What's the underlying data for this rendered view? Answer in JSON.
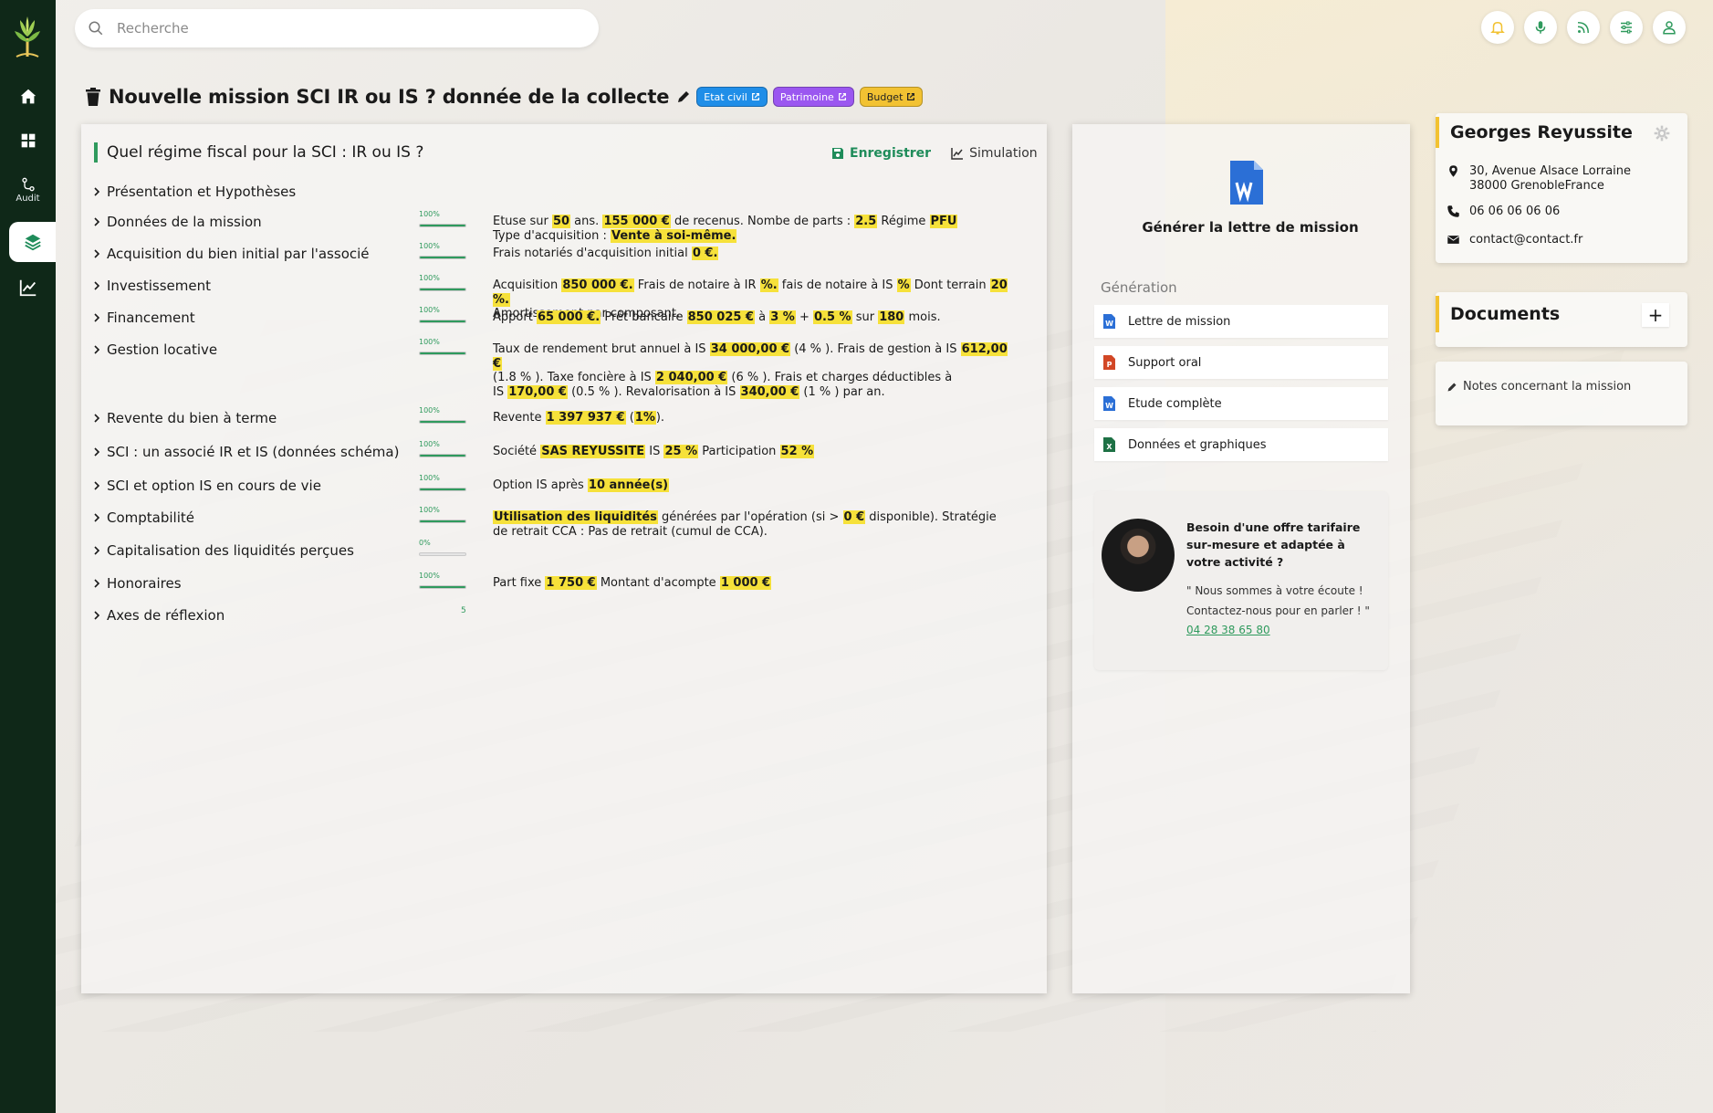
{
  "sidebar": {
    "audit_label": "Audit"
  },
  "search": {
    "placeholder": "Recherche"
  },
  "title": "Nouvelle mission SCI IR ou IS ? donnée de la collecte",
  "tags": [
    {
      "label": "Etat civil",
      "color": "#1f8ee8"
    },
    {
      "label": "Patrimoine",
      "color": "#9b57f0"
    },
    {
      "label": "Budget",
      "color": "#f2c232"
    }
  ],
  "panel": {
    "question": "Quel régime fiscal pour la SCI : IR ou IS ?",
    "save_label": "Enregistrer",
    "simulation_label": "Simulation"
  },
  "sections": [
    {
      "label": "Présentation et Hypothèses"
    },
    {
      "label": "Données de la mission",
      "progress_text": "100%",
      "progress": 1.0,
      "parts": [
        [
          "Etuse sur ",
          ""
        ],
        [
          "50",
          "h"
        ],
        [
          " ans.  ",
          ""
        ],
        [
          "155 000 €",
          "h"
        ],
        [
          " de recenus. Nombe de parts : ",
          ""
        ],
        [
          "2.5",
          "h"
        ],
        [
          " Régime ",
          ""
        ],
        [
          "PFU",
          "h"
        ],
        [
          "\nType d'acquisition : ",
          ""
        ],
        [
          "Vente à soi-même.",
          "h"
        ]
      ]
    },
    {
      "label": "Acquisition du bien initial par l'associé",
      "progress_text": "100%",
      "progress": 1.0,
      "parts": [
        [
          "Frais notariés d'acquisition initial ",
          ""
        ],
        [
          "0 €.",
          "h"
        ]
      ]
    },
    {
      "label": "Investissement",
      "progress_text": "100%",
      "progress": 1.0,
      "parts": [
        [
          "Acquisition ",
          ""
        ],
        [
          "850 000 €.",
          "h"
        ],
        [
          " Frais de notaire à IR ",
          ""
        ],
        [
          " %.",
          "h"
        ],
        [
          " fais de notaire à IS ",
          ""
        ],
        [
          "%",
          "h"
        ],
        [
          " Dont terrain ",
          ""
        ],
        [
          "20 %.",
          "h"
        ],
        [
          "\nAmortissement par composant.",
          ""
        ]
      ]
    },
    {
      "label": "Financement",
      "progress_text": "100%",
      "progress": 1.0,
      "parts": [
        [
          "Apport ",
          ""
        ],
        [
          "65 000 €.",
          "h"
        ],
        [
          " Prêt bancaire ",
          ""
        ],
        [
          "850 025 €",
          "h"
        ],
        [
          " à ",
          ""
        ],
        [
          "3 %",
          "h"
        ],
        [
          " + ",
          ""
        ],
        [
          "0.5 %",
          "h"
        ],
        [
          " sur ",
          ""
        ],
        [
          "180",
          "h"
        ],
        [
          " mois.",
          ""
        ]
      ]
    },
    {
      "label": "Gestion locative",
      "progress_text": "100%",
      "progress": 1.0,
      "parts": [
        [
          "Taux de rendement brut annuel à IS ",
          ""
        ],
        [
          "34 000,00 €",
          "h"
        ],
        [
          " (4 % ). Frais de gestion à IS ",
          ""
        ],
        [
          "612,00 €",
          "h"
        ],
        [
          "\n(1.8 % ).  Taxe foncière à IS ",
          ""
        ],
        [
          "2 040,00 €",
          "h"
        ],
        [
          "  (6 % ). Frais et charges déductibles à\nIS ",
          ""
        ],
        [
          "170,00 €",
          "h"
        ],
        [
          " (0.5 % ).  Revalorisation à IS ",
          ""
        ],
        [
          "340,00 €",
          "h"
        ],
        [
          " (1 % ) par an.",
          ""
        ]
      ]
    },
    {
      "label": "Revente du bien à terme",
      "progress_text": "100%",
      "progress": 1.0,
      "parts": [
        [
          "Revente ",
          ""
        ],
        [
          "1 397 937 €",
          "h"
        ],
        [
          " (",
          ""
        ],
        [
          "1%",
          "h"
        ],
        [
          ").",
          ""
        ]
      ]
    },
    {
      "label": "SCI : un associé IR et IS (données schéma)",
      "progress_text": "100%",
      "progress": 1.0,
      "parts": [
        [
          "Société ",
          ""
        ],
        [
          "SAS REYUSSITE",
          "h"
        ],
        [
          " IS ",
          ""
        ],
        [
          "25 %",
          "h"
        ],
        [
          " Participation ",
          ""
        ],
        [
          "52 %",
          "h"
        ]
      ]
    },
    {
      "label": "SCI et option IS en cours de vie",
      "progress_text": "100%",
      "progress": 1.0,
      "parts": [
        [
          "Option IS après ",
          ""
        ],
        [
          "10  année(s)",
          "h"
        ]
      ]
    },
    {
      "label": "Comptabilité",
      "progress_text": "100%",
      "progress": 1.0,
      "parts": [
        [
          "Utilisation des liquidités",
          "h"
        ],
        [
          " générées par l'opération (si > ",
          ""
        ],
        [
          "0 €",
          "h"
        ],
        [
          " disponible). Stratégie\nde retrait CCA : Pas de retrait (cumul de CCA).",
          ""
        ]
      ]
    },
    {
      "label": "Capitalisation des liquidités perçues",
      "progress_text": "0%",
      "progress": 0.0
    },
    {
      "label": "Honoraires",
      "progress_text": "100%",
      "progress": 1.0,
      "parts": [
        [
          "Part fixe ",
          ""
        ],
        [
          "1 750 €",
          "h"
        ],
        [
          " Montant d'acompte ",
          ""
        ],
        [
          "1 000 €",
          "h"
        ]
      ]
    },
    {
      "label": "Axes de réflexion",
      "count": "5"
    }
  ],
  "generation": {
    "title": "Générer la lettre de mission",
    "subtitle": "Génération",
    "docs": [
      {
        "label": "Lettre de mission",
        "icon": "word-icon",
        "color": "#2b6fd6"
      },
      {
        "label": "Support oral",
        "icon": "powerpoint-icon",
        "color": "#d24726"
      },
      {
        "label": "Etude complète",
        "icon": "word-icon",
        "color": "#2b6fd6"
      },
      {
        "label": "Données et graphiques",
        "icon": "excel-icon",
        "color": "#1e7145"
      }
    ],
    "offer_heading": "Besoin d'une offre tarifaire sur-mesure et adaptée à votre activité ?",
    "offer_text": "\" Nous sommes à votre écoute ! Contactez-nous pour en parler ! \"",
    "offer_phone": "04 28 38 65 80"
  },
  "contact": {
    "name": "Georges Reyussite",
    "address_line1": "30, Avenue Alsace Lorraine",
    "address_line2": "38000 GrenobleFrance",
    "phone": "06 06 06 06 06",
    "email": "contact@contact.fr"
  },
  "documents": {
    "title": "Documents",
    "add_label": "+",
    "notes_label": "Notes concernant la mission"
  },
  "colors": {
    "sidebar": "#0f2818",
    "accent_green": "#2f9a5d",
    "highlight": "#f6e13a",
    "accent_yellow": "#f2c232"
  }
}
